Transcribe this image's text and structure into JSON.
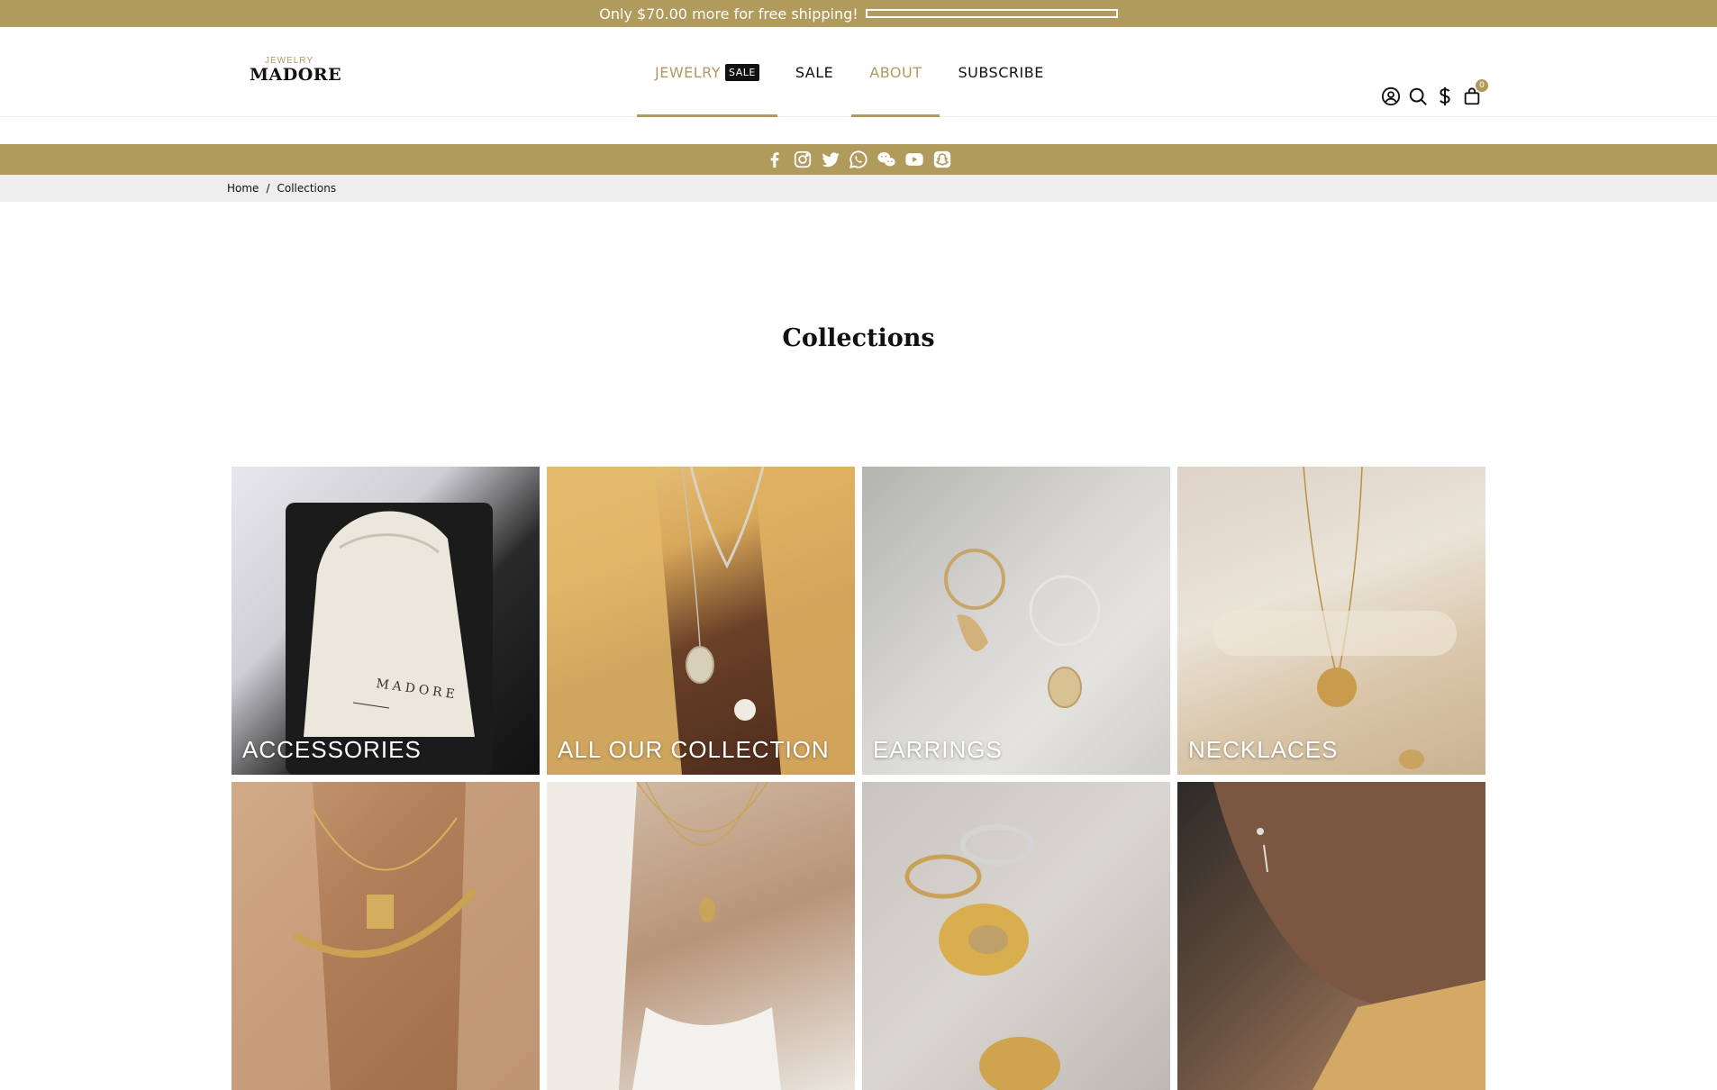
{
  "promo": {
    "text": "Only $70.00 more for free shipping!",
    "progress_fraction": 0.0
  },
  "logo": {
    "small": "JEWELRY",
    "big": "MADORE"
  },
  "nav": [
    {
      "label": "JEWELRY",
      "badge": "SALE",
      "color": "#b09a5c",
      "active": true
    },
    {
      "label": "SALE",
      "color": "#111111",
      "active": false
    },
    {
      "label": "ABOUT",
      "color": "#b09a5c",
      "active": true
    },
    {
      "label": "SUBSCRIBE",
      "color": "#111111",
      "active": false
    }
  ],
  "header_icons": [
    "account-icon",
    "search-icon",
    "currency-icon",
    "cart-icon"
  ],
  "cart": {
    "count": "0"
  },
  "social": [
    "facebook-icon",
    "instagram-icon",
    "twitter-icon",
    "whatsapp-icon",
    "wechat-icon",
    "youtube-icon",
    "snapchat-icon"
  ],
  "breadcrumb": {
    "home": "Home",
    "separator": "/",
    "current": "Collections"
  },
  "page_title": "Collections",
  "collections": [
    {
      "label": "ACCESSORIES"
    },
    {
      "label": "ALL OUR COLLECTION"
    },
    {
      "label": "EARRINGS"
    },
    {
      "label": "NECKLACES"
    },
    {
      "label": ""
    },
    {
      "label": ""
    },
    {
      "label": ""
    },
    {
      "label": ""
    }
  ],
  "colors": {
    "accent": "#b09a5c",
    "breadcrumb_bg": "#eeeeee",
    "text": "#111111"
  }
}
